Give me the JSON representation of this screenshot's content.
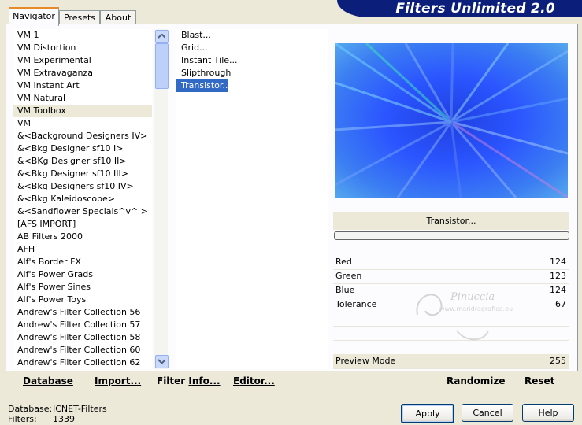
{
  "header": {
    "title": "Filters Unlimited 2.0"
  },
  "tabs": [
    {
      "label": "Navigator",
      "active": true
    },
    {
      "label": "Presets",
      "active": false
    },
    {
      "label": "About",
      "active": false
    }
  ],
  "categories": [
    "VM 1",
    "VM Distortion",
    "VM Experimental",
    "VM Extravaganza",
    "VM Instant Art",
    "VM Natural",
    "VM Toolbox",
    "VM",
    "&<Background Designers IV>",
    "&<Bkg Designer sf10 I>",
    "&<BKg Designer sf10 II>",
    "&<Bkg Designer sf10 III>",
    "&<Bkg Designers sf10 IV>",
    "&<Bkg Kaleidoscope>",
    "&<Sandflower Specials^v^ >",
    "[AFS IMPORT]",
    "AB Filters 2000",
    "AFH",
    "Alf's Border FX",
    "Alf's Power Grads",
    "Alf's Power Sines",
    "Alf's Power Toys",
    "Andrew's Filter Collection 56",
    "Andrew's Filter Collection 57",
    "Andrew's Filter Collection 58",
    "Andrew's Filter Collection 60",
    "Andrew's Filter Collection 62"
  ],
  "selected_category": "VM Toolbox",
  "filters": [
    "Blast...",
    "Grid...",
    "Instant Tile...",
    "Slipthrough",
    "Transistor..."
  ],
  "selected_filter": "Transistor...",
  "filter_name": "Transistor...",
  "params": [
    {
      "label": "Red",
      "value": "124"
    },
    {
      "label": "Green",
      "value": "123"
    },
    {
      "label": "Blue",
      "value": "124"
    },
    {
      "label": "Tolerance",
      "value": "67"
    }
  ],
  "preview_mode": {
    "label": "Preview Mode",
    "value": "255"
  },
  "toolbar": {
    "database": {
      "ul": "D",
      "rest": "atabase"
    },
    "import": {
      "ul": "I",
      "rest": "mport..."
    },
    "filter_info": {
      "pre": "Filter ",
      "ul": "I",
      "rest": "nfo..."
    },
    "editor": {
      "ul": "E",
      "rest": "ditor..."
    },
    "randomize": "Randomize",
    "reset": "Reset"
  },
  "status": {
    "database_label": "Database:",
    "database_value": "ICNET-Filters",
    "filters_label": "Filters:",
    "filters_value": "1339"
  },
  "buttons": {
    "apply": "Apply",
    "cancel": "Cancel",
    "help": "Help"
  },
  "watermark": {
    "name": "Pinuccia",
    "url": "www.maridragrafica.eu"
  },
  "colors": {
    "selection": "#316ac5",
    "banner": "#0b1f7a",
    "dialog": "#ece9d8"
  },
  "icons": {
    "scroll_up": "up-arrow-icon",
    "scroll_down": "down-arrow-icon"
  }
}
